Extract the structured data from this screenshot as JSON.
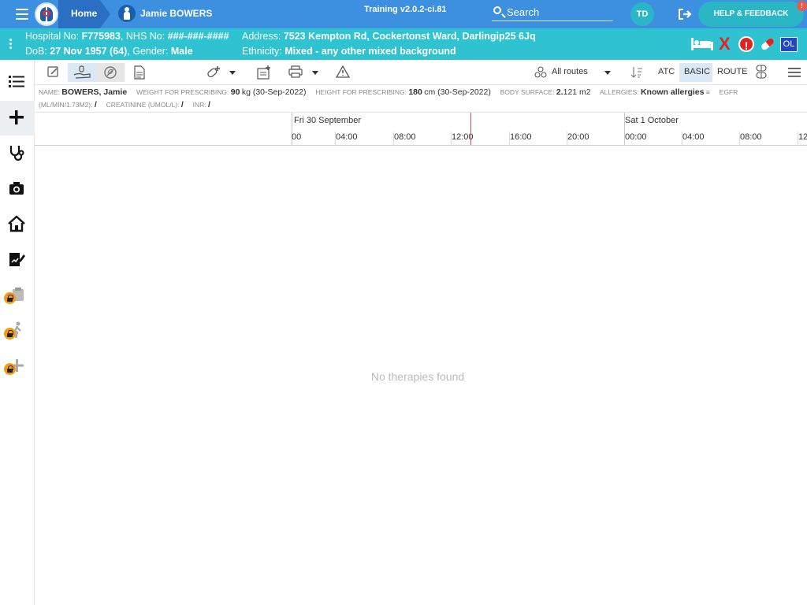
{
  "app": {
    "home_label": "Home",
    "patient_crumb": "Jamie BOWERS",
    "version": "Training v2.0.2-ci.81",
    "search_label": "Search",
    "user_initials": "TD",
    "help_label": "HELP & FEEDBACK",
    "help_badge": "!"
  },
  "banner": {
    "hospital_label": "Hospital No:",
    "hospital_value": "F775983",
    "nhs_label": "NHS No:",
    "nhs_value": "###-###-####",
    "dob_label": "DoB:",
    "dob_value": "27 Nov 1957 (64)",
    "gender_label": "Gender:",
    "gender_value": "Male",
    "address_label": "Address:",
    "address_value": "7523 Kempton Rd, Cockertonst Ward, Darlingip25 6Jq",
    "ethnicity_label": "Ethnicity:",
    "ethnicity_value": "Mixed - any other mixed background",
    "x_mark": "X",
    "alert_mark": "!",
    "ol_badge": "OL"
  },
  "toolbar": {
    "routes_label": "All routes",
    "atc_label": "ATC",
    "basic_label": "BASIC",
    "route_label": "ROUTE"
  },
  "patient_info": {
    "name_label": "NAME:",
    "name_value": "BOWERS, Jamie",
    "weight_label": "WEIGHT FOR PRESCRIBING:",
    "weight_value": "90",
    "weight_unit": "kg (30-Sep-2022)",
    "height_label": "HEIGHT FOR PRESCRIBING:",
    "height_value": "180",
    "height_unit": "cm (30-Sep-2022)",
    "bsa_label": "BODY SURFACE:",
    "bsa_value_int": "2.",
    "bsa_value_dec": "121 m2",
    "allergies_label": "ALLERGIES:",
    "allergies_value": "Known allergies",
    "egfr_label": "EGFR",
    "egfr_unit": "(ML/MIN/1.73M2):",
    "egfr_value": "/",
    "creatinine_label": "CREATININE (UMOL/L):",
    "creatinine_value": "/",
    "inr_label": "INR:",
    "inr_value": "/"
  },
  "timeline": {
    "day1": "Fri 30 September",
    "day2": "Sat 1 October",
    "times": [
      "00",
      "04:00",
      "08:00",
      "12:00",
      "16:00",
      "20:00",
      "00:00",
      "04:00",
      "08:00",
      "12"
    ]
  },
  "empty_message": "No therapies found",
  "colors": {
    "topbar": "#3d8fe0",
    "banner": "#2fc3d1",
    "accent": "#2bb6c6",
    "alert": "#e1241f",
    "now_line": "#e24b4b"
  }
}
